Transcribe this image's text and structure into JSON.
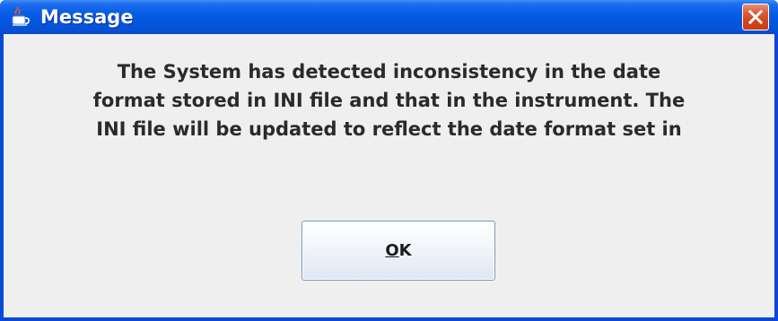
{
  "dialog": {
    "title": "Message",
    "title_icon": "java-cup-icon",
    "close_icon": "close-icon",
    "message_lines": [
      "The System has detected inconsistency in the date",
      "format stored in INI file and that in the instrument. The",
      "INI file will be updated to reflect the date format set in"
    ],
    "ok_button": {
      "mnemonic": "O",
      "rest": "K"
    }
  },
  "colors": {
    "titlebar": "#0556e0",
    "close_button": "#cf4418",
    "client_background": "#efefef"
  }
}
